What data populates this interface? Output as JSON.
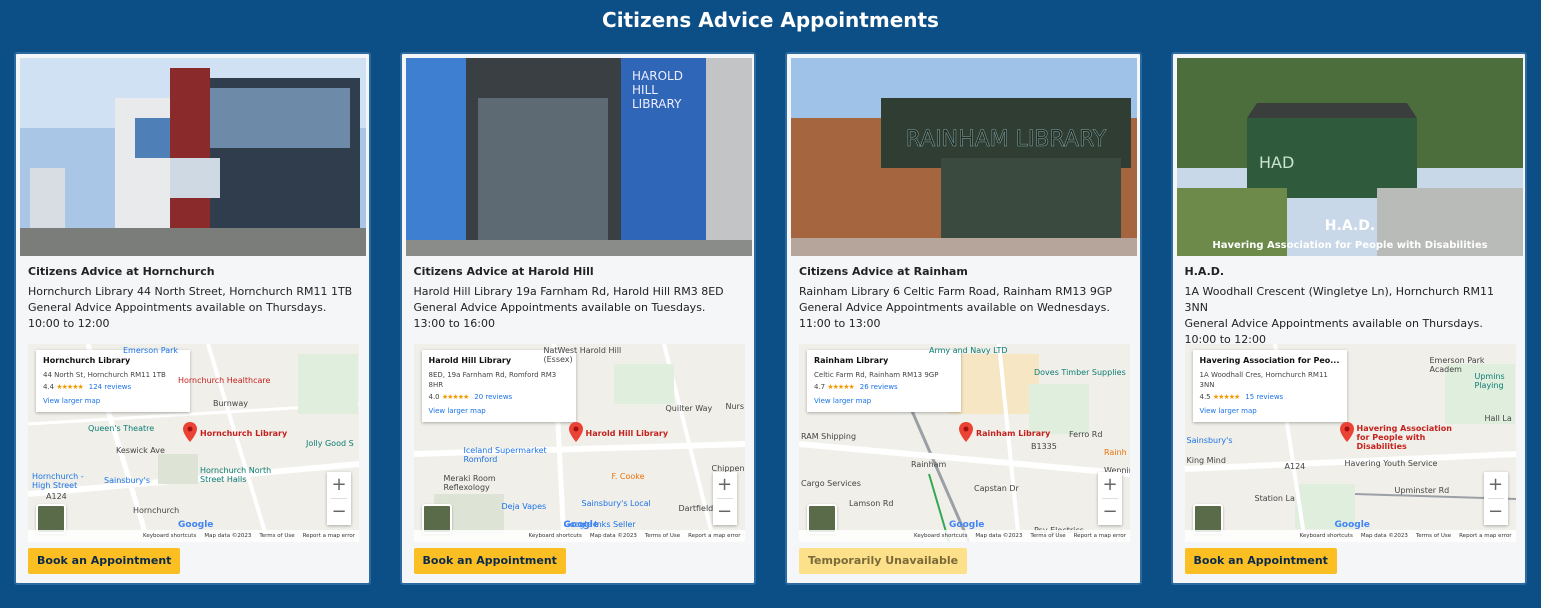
{
  "page": {
    "title": "Citizens Advice Appointments"
  },
  "cards": [
    {
      "name": "Citizens Advice at Hornchurch",
      "address": "Hornchurch Library 44 North Street, Hornchurch RM11 1TB",
      "availability": "General Advice Appointments available on Thursdays.",
      "hours": "10:00 to 12:00",
      "map": {
        "title": "Hornchurch Library",
        "address": "44 North St, Hornchurch RM11 1TB",
        "rating": "4.4",
        "stars": "★★★★★",
        "reviews": "124 reviews",
        "larger": "View larger map",
        "pin_label": "Hornchurch Library"
      },
      "button": "Book an Appointment"
    },
    {
      "name": "Citizens Advice at Harold Hill",
      "address": "Harold Hill Library 19a Farnham Rd, Harold Hill RM3 8ED",
      "availability": "General Advice Appointments available on Tuesdays.",
      "hours": "13:00 to 16:00",
      "map": {
        "title": "Harold Hill Library",
        "address": "8ED, 19a Farnham Rd, Romford RM3 8HR",
        "rating": "4.0",
        "stars": "★★★★★",
        "reviews": "20 reviews",
        "larger": "View larger map",
        "pin_label": "Harold Hill Library"
      },
      "button": "Book an Appointment"
    },
    {
      "name": "Citizens Advice at Rainham",
      "address": "Rainham Library 6 Celtic Farm Road, Rainham RM13 9GP",
      "availability": "General Advice Appointments available on Wednesdays.",
      "hours": "11:00 to 13:00",
      "map": {
        "title": "Rainham Library",
        "address": "Celtic Farm Rd, Rainham RM13 9GP",
        "rating": "4.7",
        "stars": "★★★★★",
        "reviews": "26 reviews",
        "larger": "View larger map",
        "pin_label": "Rainham Library"
      },
      "button": "Temporarily Unavailable"
    },
    {
      "name": "H.A.D.",
      "address": "1A Woodhall Crescent (Wingletye Ln), Hornchurch RM11 3NN",
      "availability": "General Advice Appointments available on Thursdays.",
      "hours": "10:00 to 12:00",
      "map": {
        "title": "Havering Association for Peo...",
        "address": "1A Woodhall Cres, Hornchurch RM11 3NN",
        "rating": "4.5",
        "stars": "★★★★★",
        "reviews": "15 reviews",
        "larger": "View larger map",
        "pin_label": "Havering Association for People with Disabilities"
      },
      "button": "Book an Appointment"
    }
  ],
  "map_labels": {
    "c0": [
      "Emerson Park",
      "Hornchurch Healthcare",
      "Queen's Theatre",
      "Jolly Good S",
      "Hornchurch North Street Halls",
      "Sainsbury's",
      "Hornchurch - High Street",
      "Hornchurch",
      "A124",
      "Burnway",
      "Keswick Ave"
    ],
    "c1": [
      "NatWest Harold Hill (Essex)",
      "Iceland Supermarket Romford",
      "Meraki Room Reflexology",
      "Deja Vapes",
      "Sainsbury's Local",
      "F. Cooke",
      "Quilter Way",
      "Chippenh",
      "Dartfields",
      "Nurs",
      "Google Inks Seller"
    ],
    "c2": [
      "Army and Navy LTD",
      "Doves Timber Supplies",
      "RAM Shipping",
      "Rainham",
      "B1335",
      "Ferro Rd",
      "Wennin",
      "Cargo Services",
      "Lamson Rd",
      "Psv Electrics",
      "Rainh",
      "Capstan Dr"
    ],
    "c3": [
      "Emerson Park Academ",
      "Upmins Playing",
      "Havering Youth Service",
      "Sainsbury's",
      "King Mind",
      "A124",
      "Upminster Rd",
      "Station La",
      "Hall La"
    ]
  },
  "map_footer": {
    "shortcuts": "Keyboard shortcuts",
    "data": "Map data ©2023",
    "terms": "Terms of Use",
    "report": "Report a map error",
    "google": "Google",
    "zoom_in": "+",
    "zoom_out": "−"
  },
  "photo_signs": {
    "c1": "HAROLD HILL LIBRARY",
    "c2": "RAINHAM LIBRARY",
    "c3a": "HAD",
    "c3b": "H.A.D.",
    "c3c": "Havering Association for People with Disabilities"
  },
  "colors": {
    "background": "#0b4f86",
    "button": "#fbbf24",
    "button_disabled": "#fde08a",
    "pin": "#ea4335"
  }
}
